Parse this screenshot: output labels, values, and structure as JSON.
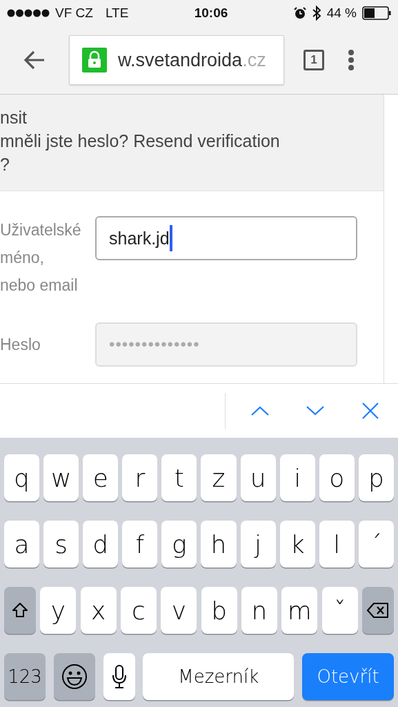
{
  "status_bar": {
    "carrier": "VF CZ",
    "network": "LTE",
    "time": "10:06",
    "battery": "44 %"
  },
  "browser": {
    "url_main": "w.svetandroida",
    "url_tld": ".cz",
    "tab_count": "1"
  },
  "page": {
    "header_lines": [
      "nsit",
      "mněli jste heslo? Resend verification",
      "?"
    ],
    "username": {
      "label_lines": [
        "Uživatelské",
        "méno,",
        "nebo email"
      ],
      "value": "shark.jd",
      "focused": true
    },
    "password": {
      "label": "Heslo",
      "masked": "••••••••••••••"
    }
  },
  "keyboard": {
    "rows": [
      {
        "keys": [
          {
            "kind": "char",
            "label": "q"
          },
          {
            "kind": "char",
            "label": "w"
          },
          {
            "kind": "char",
            "label": "e"
          },
          {
            "kind": "char",
            "label": "r"
          },
          {
            "kind": "char",
            "label": "t"
          },
          {
            "kind": "char",
            "label": "z"
          },
          {
            "kind": "char",
            "label": "u"
          },
          {
            "kind": "char",
            "label": "i"
          },
          {
            "kind": "char",
            "label": "o"
          },
          {
            "kind": "char",
            "label": "p"
          }
        ]
      },
      {
        "keys": [
          {
            "kind": "char",
            "label": "a"
          },
          {
            "kind": "char",
            "label": "s"
          },
          {
            "kind": "char",
            "label": "d"
          },
          {
            "kind": "char",
            "label": "f"
          },
          {
            "kind": "char",
            "label": "g"
          },
          {
            "kind": "char",
            "label": "h"
          },
          {
            "kind": "char",
            "label": "j"
          },
          {
            "kind": "char",
            "label": "k"
          },
          {
            "kind": "char",
            "label": "l"
          },
          {
            "kind": "char",
            "label": "´"
          }
        ]
      },
      {
        "keys": [
          {
            "kind": "shift"
          },
          {
            "kind": "char",
            "label": "y"
          },
          {
            "kind": "char",
            "label": "x"
          },
          {
            "kind": "char",
            "label": "c"
          },
          {
            "kind": "char",
            "label": "v"
          },
          {
            "kind": "char",
            "label": "b"
          },
          {
            "kind": "char",
            "label": "n"
          },
          {
            "kind": "char",
            "label": "m"
          },
          {
            "kind": "char",
            "label": "ˇ"
          },
          {
            "kind": "delete"
          }
        ]
      },
      {
        "keys": [
          {
            "kind": "numbers",
            "label": "123"
          },
          {
            "kind": "emoji"
          },
          {
            "kind": "mic"
          },
          {
            "kind": "space",
            "label": "Mezerník"
          },
          {
            "kind": "go",
            "label": "Otevřít"
          }
        ]
      }
    ]
  }
}
